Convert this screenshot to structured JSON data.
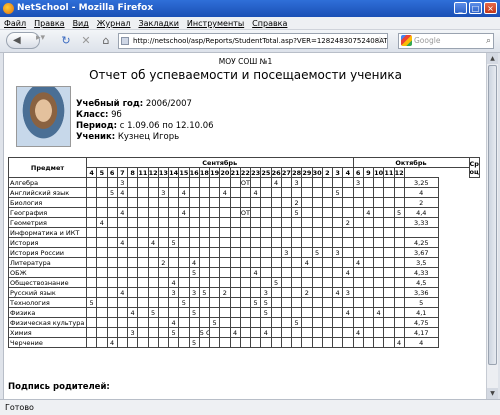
{
  "window": {
    "title": "NetSchool - Mozilla Firefox"
  },
  "menu": [
    "Файл",
    "Правка",
    "Вид",
    "Журнал",
    "Закладки",
    "Инструменты",
    "Справка"
  ],
  "nav": {
    "url": "http://netschool/asp/Reports/StudentTotal.asp?VER=12824830752408AT",
    "search_placeholder": "Google"
  },
  "status": "Готово",
  "report": {
    "school": "МОУ СОШ №1",
    "title": "Отчет об успеваемости и посещаемости ученика",
    "year_label": "Учебный год:",
    "year": "2006/2007",
    "class_label": "Класс:",
    "class": "9б",
    "period_label": "Период:",
    "period": "с 1.09.06 по 12.10.06",
    "student_label": "Ученик:",
    "student": "Кузнец Игорь",
    "col_subject": "Предмет",
    "col_average": "Средняя оценка",
    "months": [
      {
        "name": "Сентябрь",
        "span": 26
      },
      {
        "name": "Октябрь",
        "span": 9
      }
    ],
    "days": [
      "4",
      "5",
      "6",
      "7",
      "8",
      "11",
      "12",
      "13",
      "14",
      "15",
      "16",
      "18",
      "19",
      "20",
      "21",
      "22",
      "23",
      "25",
      "26",
      "27",
      "28",
      "29",
      "30",
      "2",
      "3",
      "4",
      "6",
      "9",
      "10",
      "11",
      "12"
    ],
    "rows": [
      {
        "subject": "Алгебра",
        "marks": {
          "3": "3",
          "15": "ОТ",
          "18": "4",
          "20": "3",
          "26": "3"
        },
        "avg": "3,25"
      },
      {
        "subject": "Английский язык",
        "marks": {
          "2": "5",
          "3": "4",
          "7": "3",
          "9": "4",
          "13": "4",
          "16": "4",
          "24": "5"
        },
        "avg": "4"
      },
      {
        "subject": "Биология",
        "marks": {
          "20": "2"
        },
        "avg": "2"
      },
      {
        "subject": "География",
        "marks": {
          "3": "4",
          "9": "4",
          "15": "ОТ",
          "20": "5",
          "27": "4",
          "30": "5"
        },
        "avg": "4,4"
      },
      {
        "subject": "Геометрия",
        "marks": {
          "1": "4",
          "25": "2"
        },
        "avg": "3,33"
      },
      {
        "subject": "Информатика и ИКТ",
        "marks": {},
        "avg": ""
      },
      {
        "subject": "История",
        "marks": {
          "3": "4",
          "6": "4",
          "8": "5"
        },
        "avg": "4,25"
      },
      {
        "subject": "История России",
        "marks": {
          "19": "3",
          "22": "5",
          "24": "3"
        },
        "avg": "3,67"
      },
      {
        "subject": "Литература",
        "marks": {
          "7": "2",
          "10": "4",
          "21": "4",
          "26": "4"
        },
        "avg": "3,5"
      },
      {
        "subject": "ОБЖ",
        "marks": {
          "10": "5",
          "16": "4",
          "25": "4"
        },
        "avg": "4,33"
      },
      {
        "subject": "Обществознание",
        "marks": {
          "8": "4",
          "18": "5"
        },
        "avg": "4,5"
      },
      {
        "subject": "Русский язык",
        "marks": {
          "3": "4",
          "8": "3",
          "10": "3",
          "11": "5",
          "13": "2",
          "17": "3",
          "21": "2",
          "24": "4",
          "25": "3"
        },
        "avg": "3,36"
      },
      {
        "subject": "Технология",
        "marks": {
          "0": "5",
          "9": "5",
          "16": "5",
          "17": "5"
        },
        "avg": "5"
      },
      {
        "subject": "Физика",
        "marks": {
          "4": "4",
          "6": "5",
          "10": "5",
          "17": "5",
          "25": "4",
          "28": "4"
        },
        "avg": "4,1"
      },
      {
        "subject": "Физическая культура",
        "marks": {
          "8": "4",
          "12": "5",
          "20": "5"
        },
        "avg": "4,75"
      },
      {
        "subject": "Химия",
        "marks": {
          "4": "3",
          "8": "5",
          "11": "5 ОП",
          "14": "4",
          "17": "4",
          "26": "4"
        },
        "avg": "4,17"
      },
      {
        "subject": "Черчение",
        "marks": {
          "2": "4",
          "10": "5",
          "30": "4"
        },
        "avg": "4"
      }
    ],
    "signature_label": "Подпись родителей:"
  }
}
